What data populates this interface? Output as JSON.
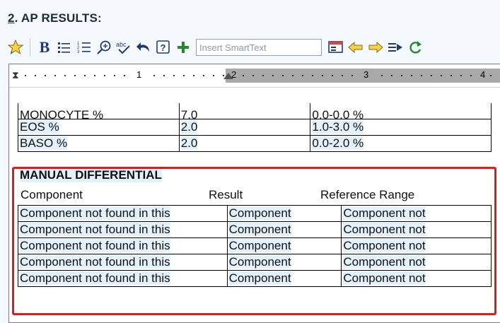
{
  "section": {
    "number": "2",
    "title": ". AP RESULTS:"
  },
  "toolbar": {
    "insert_placeholder": "Insert SmartText",
    "icons": [
      "star-icon",
      "bold-icon",
      "bullet-list-icon",
      "numbered-list-icon",
      "zoom-icon",
      "spellcheck-icon",
      "undo-icon",
      "help-icon",
      "add-icon",
      "smarttext-template-icon",
      "arrow-left-icon",
      "arrow-right-icon",
      "insert-list-icon",
      "refresh-icon"
    ]
  },
  "ruler": {
    "marks": [
      "1",
      "2",
      "3",
      "4"
    ]
  },
  "top_table": {
    "partial_row": [
      "MONOCYTE %",
      "7.0",
      "0.0-0.0 %"
    ],
    "rows": [
      [
        "EOS %",
        "2.0",
        "1.0-3.0 %"
      ],
      [
        "BASO %",
        "2.0",
        "0.0-2.0 %"
      ]
    ]
  },
  "manual": {
    "title": "MANUAL DIFFERENTIAL",
    "headers": [
      "Component",
      "Result",
      "Reference Range"
    ],
    "rows": [
      [
        "Component not found in this",
        "Component",
        "Component not"
      ],
      [
        "Component not found in this",
        "Component",
        "Component not"
      ],
      [
        "Component not found in this",
        "Component",
        "Component not"
      ],
      [
        "Component not found in this",
        "Component",
        "Component not"
      ],
      [
        "Component not found in this",
        "Component",
        "Component not"
      ]
    ]
  }
}
